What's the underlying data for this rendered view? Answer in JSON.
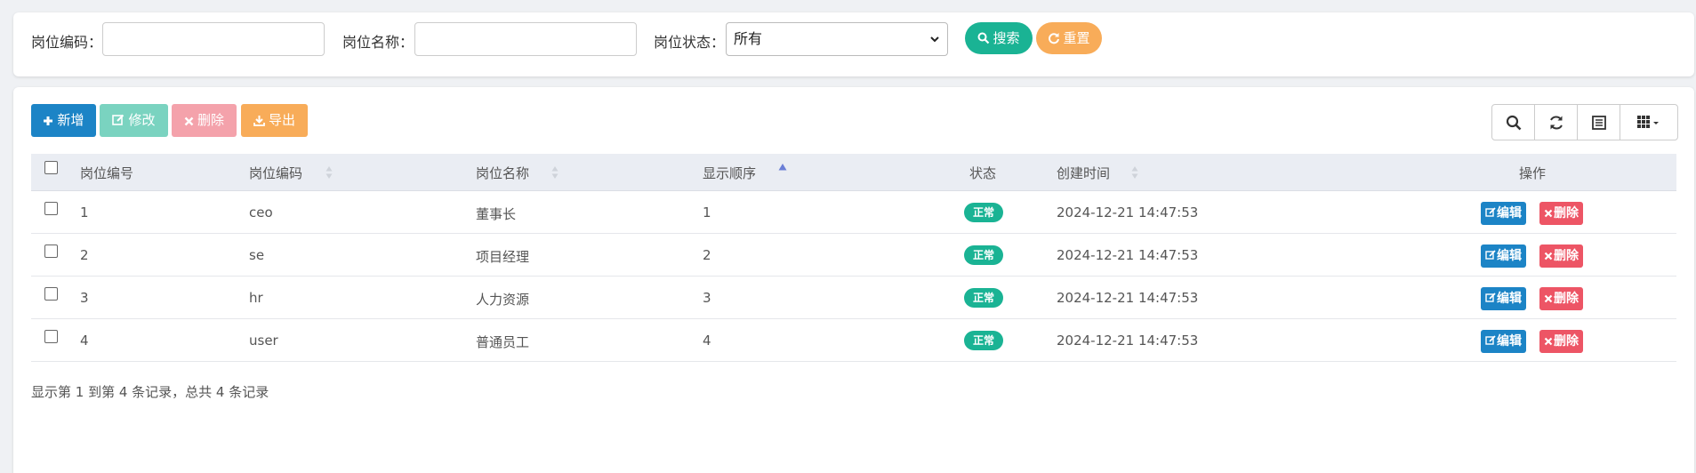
{
  "search": {
    "post_code_label": "岗位编码：",
    "post_code_value": "",
    "post_name_label": "岗位名称：",
    "post_name_value": "",
    "status_label": "岗位状态：",
    "status_selected": "所有",
    "search_button": "搜索",
    "reset_button": "重置"
  },
  "toolbar": {
    "add": "新增",
    "edit": "修改",
    "delete": "删除",
    "export": "导出"
  },
  "colors": {
    "primary": "#1c84c6",
    "success": "#1ab394",
    "danger": "#ed5565",
    "warning": "#f8ac59"
  },
  "table": {
    "headers": [
      "岗位编号",
      "岗位编码",
      "岗位名称",
      "显示顺序",
      "状态",
      "创建时间",
      "操作"
    ],
    "rows": [
      {
        "id": "1",
        "code": "ceo",
        "name": "董事长",
        "order": "1",
        "status": "正常",
        "created": "2024-12-21 14:47:53"
      },
      {
        "id": "2",
        "code": "se",
        "name": "项目经理",
        "order": "2",
        "status": "正常",
        "created": "2024-12-21 14:47:53"
      },
      {
        "id": "3",
        "code": "hr",
        "name": "人力资源",
        "order": "3",
        "status": "正常",
        "created": "2024-12-21 14:47:53"
      },
      {
        "id": "4",
        "code": "user",
        "name": "普通员工",
        "order": "4",
        "status": "正常",
        "created": "2024-12-21 14:47:53"
      }
    ],
    "edit_label": "编辑",
    "delete_label": "删除"
  },
  "pagination": {
    "summary": "显示第 1 到第 4 条记录，总共 4 条记录"
  }
}
